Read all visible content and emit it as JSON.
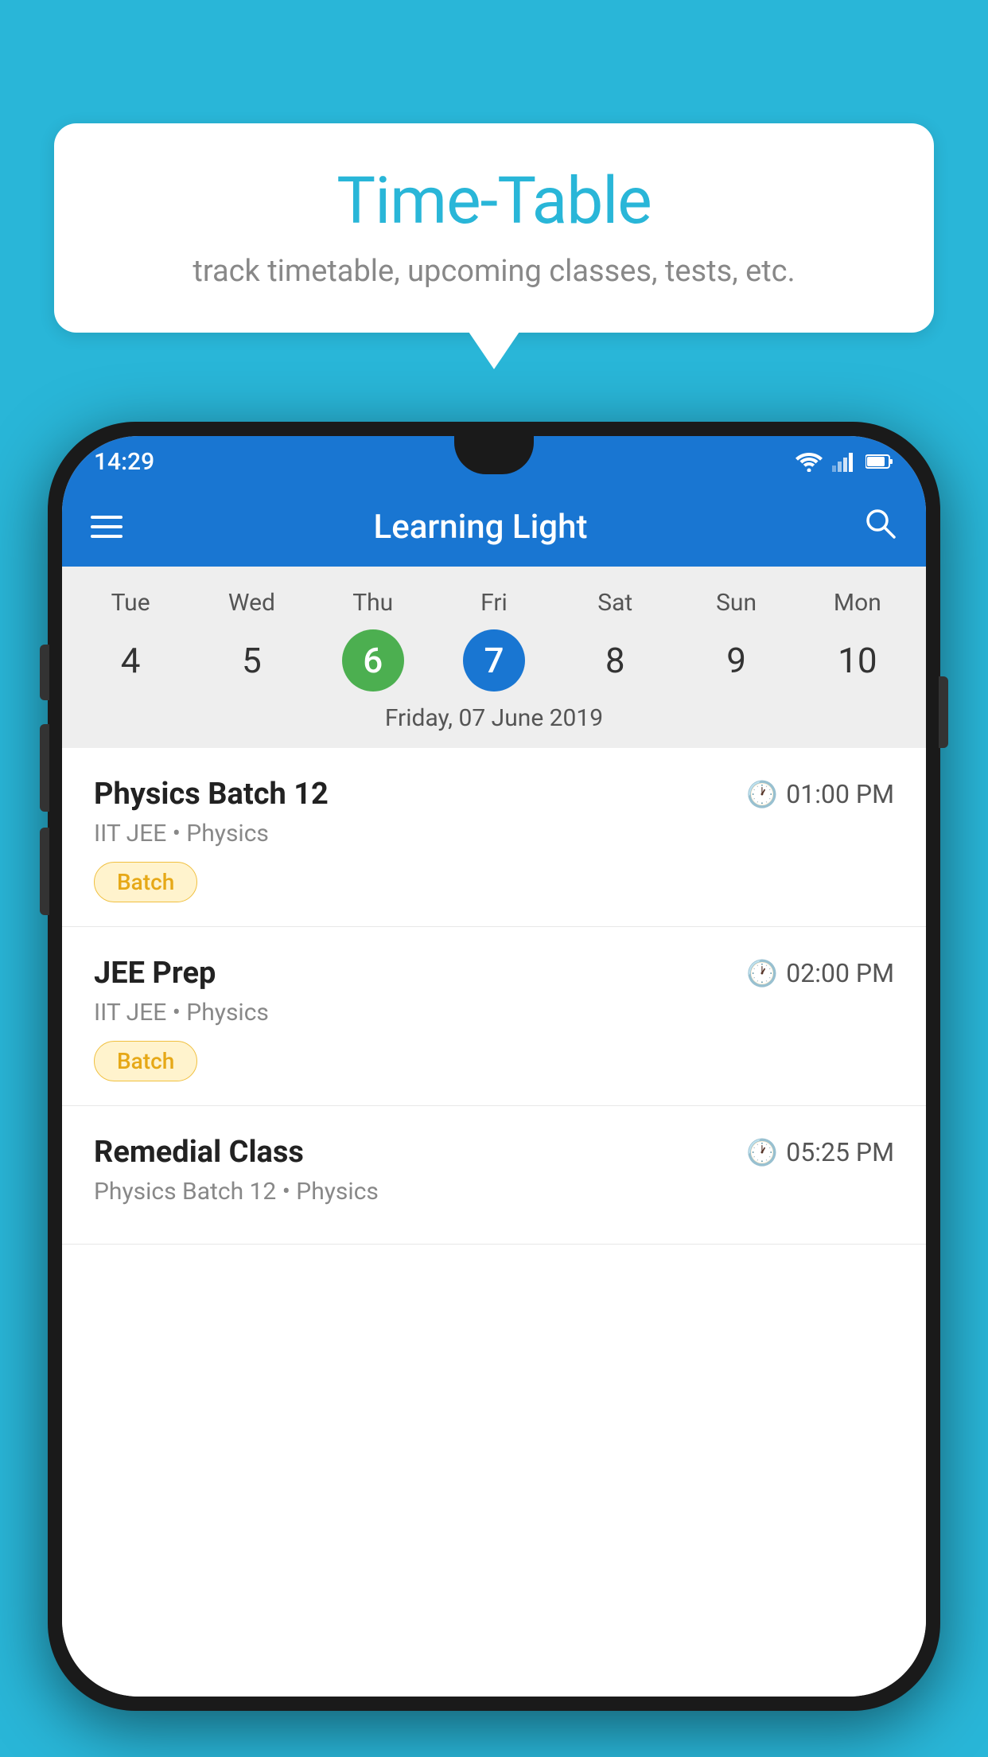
{
  "background_color": "#29B6D8",
  "bubble": {
    "title": "Time-Table",
    "subtitle": "track timetable, upcoming classes, tests, etc."
  },
  "phone": {
    "status_bar": {
      "time": "14:29"
    },
    "app_bar": {
      "title": "Learning Light"
    },
    "calendar": {
      "day_headers": [
        "Tue",
        "Wed",
        "Thu",
        "Fri",
        "Sat",
        "Sun",
        "Mon"
      ],
      "day_numbers": [
        "4",
        "5",
        "6",
        "7",
        "8",
        "9",
        "10"
      ],
      "today_index": 2,
      "selected_index": 3,
      "selected_date_label": "Friday, 07 June 2019"
    },
    "schedule": [
      {
        "name": "Physics Batch 12",
        "time": "01:00 PM",
        "meta": "IIT JEE • Physics",
        "badge": "Batch"
      },
      {
        "name": "JEE Prep",
        "time": "02:00 PM",
        "meta": "IIT JEE • Physics",
        "badge": "Batch"
      },
      {
        "name": "Remedial Class",
        "time": "05:25 PM",
        "meta": "Physics Batch 12 • Physics",
        "badge": null
      }
    ]
  }
}
